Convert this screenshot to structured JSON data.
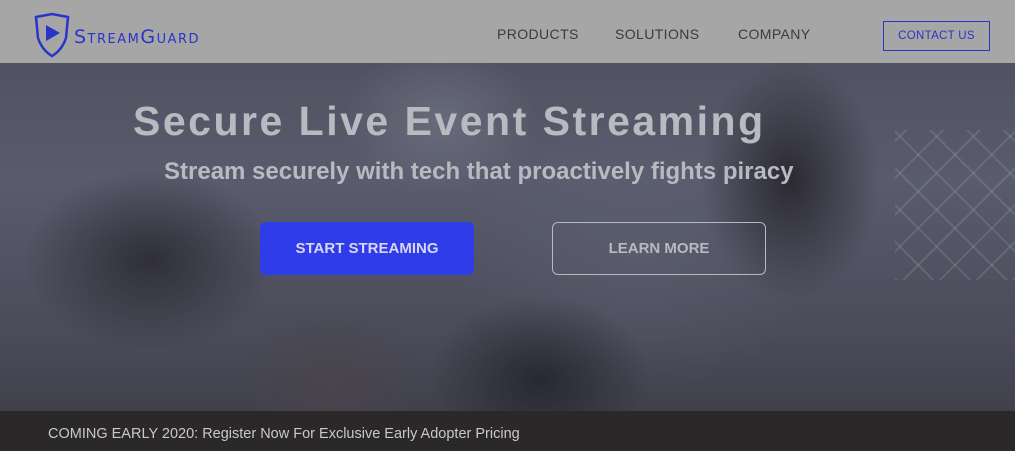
{
  "brand": {
    "name": "StreamGuard",
    "color": "#2b34c8"
  },
  "nav": {
    "products": "PRODUCTS",
    "solutions": "SOLUTIONS",
    "company": "COMPANY",
    "contact": "CONTACT US"
  },
  "hero": {
    "headline": "Secure Live Event Streaming",
    "subheadline": "Stream securely with tech that proactively fights piracy",
    "primary_button": "START STREAMING",
    "secondary_button": "LEARN MORE",
    "primary_color": "#2f3cea"
  },
  "banner": {
    "text": "COMING EARLY 2020: Register Now For Exclusive Early Adopter Pricing"
  }
}
